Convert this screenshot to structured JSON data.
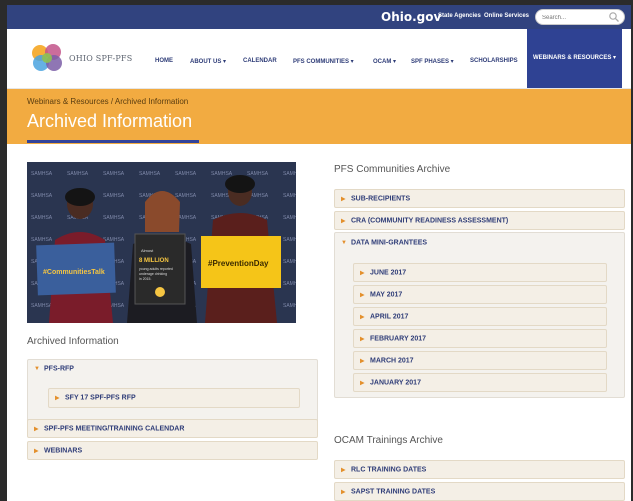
{
  "topbar": {
    "logo_text": "Ohio.gov",
    "state_agencies": "State Agencies",
    "online_services": "Online Services",
    "search_placeholder": "Search..."
  },
  "header": {
    "site_name": "OHIO SPF-PFS"
  },
  "nav": {
    "home": "HOME",
    "about": "ABOUT US ▾",
    "calendar": "CALENDAR",
    "communities": "PFS COMMUNITIES ▾",
    "ocam": "OCAM ▾",
    "phases": "SPF PHASES ▾",
    "scholarships": "SCHOLARSHIPS",
    "webinars": "WEBINARS & RESOURCES ▾"
  },
  "banner": {
    "breadcrumb": "Webinars & Resources / Archived Information",
    "title": "Archived Information"
  },
  "photo": {
    "sign_left": "#CommunitiesTalk",
    "sign_middle": "Almost 8 MILLION young adults reported underage drinking in 2015.",
    "sign_middle_big": "8 MILLION",
    "sign_right": "#PreventionDay",
    "backdrop_word": "SAMHSA"
  },
  "archived": {
    "title": "Archived Information",
    "pfs_rfp": "PFS-RFP",
    "sfy17": "SFY 17 SPF-PFS RFP",
    "meeting_calendar": "SPF-PFS MEETING/TRAINING CALENDAR",
    "webinars": "WEBINARS"
  },
  "communities_archive": {
    "title": "PFS Communities Archive",
    "sub_recipients": "SUB-RECIPIENTS",
    "cra": "CRA (COMMUNITY READINESS ASSESSMENT)",
    "data_mini": "DATA MINI-GRANTEES",
    "months": [
      "JUNE 2017",
      "MAY 2017",
      "APRIL 2017",
      "FEBRUARY 2017",
      "MARCH 2017",
      "JANUARY 2017"
    ]
  },
  "ocam_archive": {
    "title": "OCAM Trainings Archive",
    "rlc": "RLC TRAINING DATES",
    "sapst": "SAPST TRAINING DATES"
  },
  "colors": {
    "topbar": "#31437f",
    "nav_text": "#2f3d78",
    "banner": "#f2ab41",
    "accent_orange": "#e38f2b"
  }
}
